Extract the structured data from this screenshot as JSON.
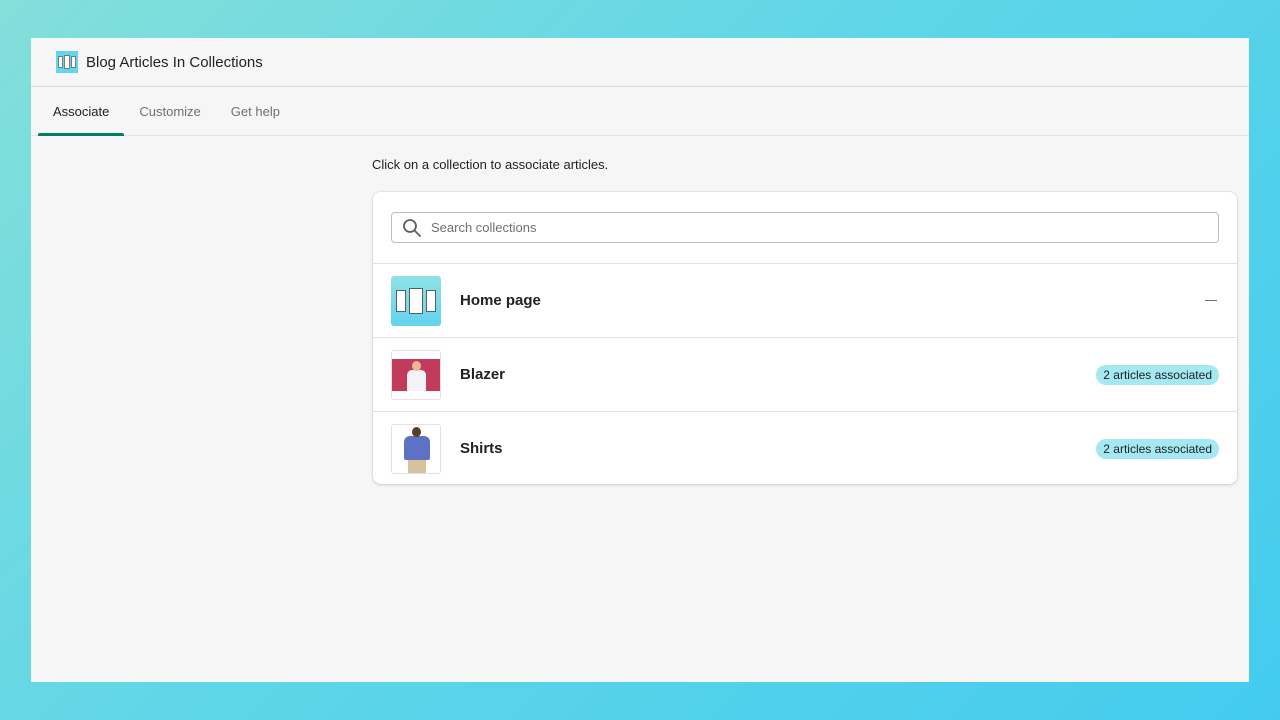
{
  "app": {
    "title": "Blog Articles In Collections",
    "logo_icon": "app-logo-icon"
  },
  "tabs": [
    {
      "label": "Associate",
      "active": true
    },
    {
      "label": "Customize",
      "active": false
    },
    {
      "label": "Get help",
      "active": false
    }
  ],
  "main": {
    "instruction": "Click on a collection to associate articles."
  },
  "search": {
    "placeholder": "Search collections",
    "value": "",
    "icon": "search-icon"
  },
  "collections": [
    {
      "title": "Home page",
      "thumbnail": "home-page-thumbnail",
      "badge": null,
      "expanded_indicator": "minus-icon"
    },
    {
      "title": "Blazer",
      "thumbnail": "blazer-thumbnail",
      "badge": "2 articles associated"
    },
    {
      "title": "Shirts",
      "thumbnail": "shirts-thumbnail",
      "badge": "2 articles associated"
    }
  ],
  "colors": {
    "accent": "#008060",
    "badge_bg": "#a4e8f2",
    "page_bg": "#f6f6f7",
    "outer_gradient_start": "#84dfd9",
    "outer_gradient_end": "#43cbee"
  }
}
